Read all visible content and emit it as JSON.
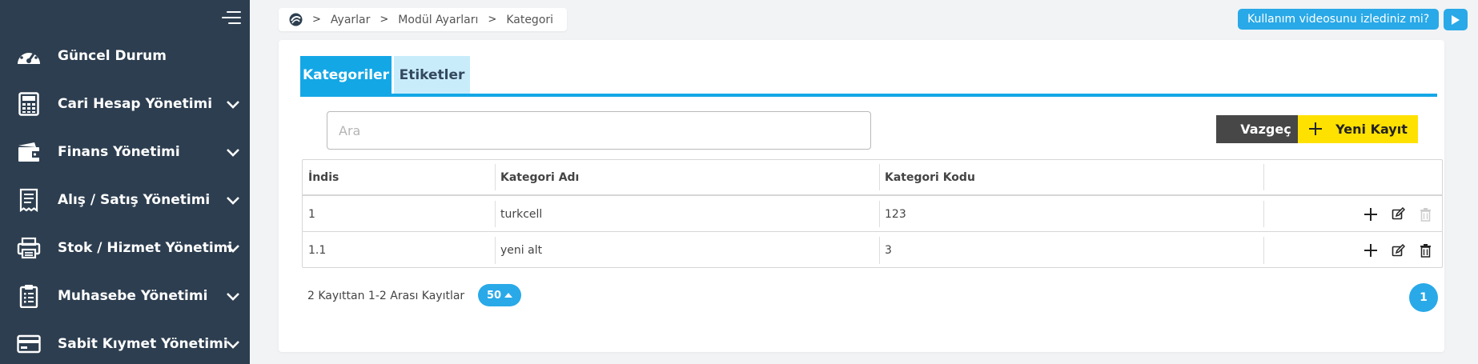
{
  "sidebar": {
    "items": [
      {
        "label": "Güncel Durum",
        "icon": "dashboard-gauge-icon",
        "has_chevron": false
      },
      {
        "label": "Cari Hesap Yönetimi",
        "icon": "calculator-icon",
        "has_chevron": true
      },
      {
        "label": "Finans Yönetimi",
        "icon": "wallet-icon",
        "has_chevron": true
      },
      {
        "label": "Alış / Satış Yönetimi",
        "icon": "receipt-icon",
        "has_chevron": true
      },
      {
        "label": "Stok / Hizmet Yönetimi",
        "icon": "printer-icon",
        "has_chevron": true
      },
      {
        "label": "Muhasebe Yönetimi",
        "icon": "clipboard-icon",
        "has_chevron": true
      },
      {
        "label": "Sabit Kıymet Yönetimi",
        "icon": "credit-card-icon",
        "has_chevron": true
      }
    ]
  },
  "breadcrumb": {
    "home_icon": "turkcell-logo-icon",
    "items": [
      "Ayarlar",
      "Modül Ayarları",
      "Kategori"
    ]
  },
  "video_help": {
    "label": "Kullanım videosunu izlediniz mi?",
    "icon": "play-icon"
  },
  "tabs": [
    {
      "label": "Kategoriler",
      "active": true
    },
    {
      "label": "Etiketler",
      "active": false
    }
  ],
  "search": {
    "placeholder": "Ara",
    "value": ""
  },
  "actions": {
    "cancel_label": "Vazgeç",
    "new_label": "Yeni Kayıt",
    "new_icon": "plus-icon"
  },
  "table": {
    "columns": [
      "İndis",
      "Kategori Adı",
      "Kategori Kodu",
      ""
    ],
    "rows": [
      {
        "index": "1",
        "name": "turkcell",
        "code": "123",
        "delete_enabled": false
      },
      {
        "index": "1.1",
        "name": "yeni alt",
        "code": "3",
        "delete_enabled": true
      }
    ]
  },
  "pagination": {
    "summary": "2 Kayıttan 1-2 Arası Kayıtlar",
    "page_size": "50",
    "current_page": "1"
  },
  "colors": {
    "sidebar_bg": "#2d3e50",
    "accent": "#14a7e6",
    "tab_inactive": "#c9ecfb",
    "cancel_button": "#474747",
    "new_button": "#ffe100"
  }
}
